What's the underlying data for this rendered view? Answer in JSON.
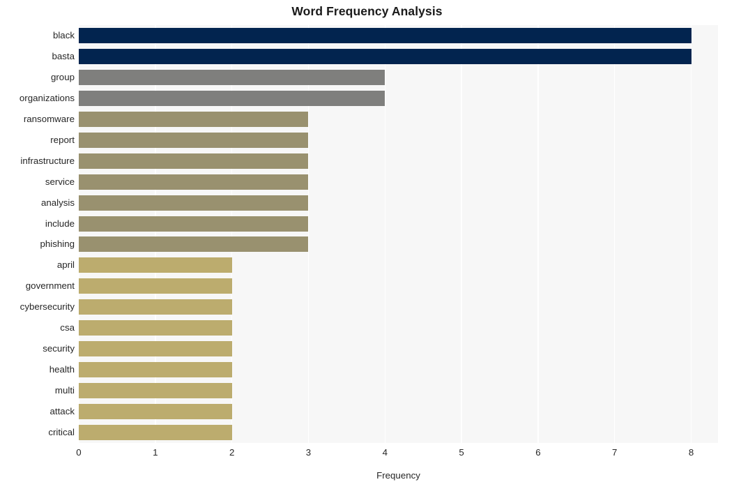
{
  "chart_data": {
    "type": "bar",
    "orientation": "horizontal",
    "title": "Word Frequency Analysis",
    "xlabel": "Frequency",
    "ylabel": "",
    "xlim": [
      0,
      8.35
    ],
    "ylim": [
      0,
      20
    ],
    "grid": true,
    "legend": null,
    "xticks": [
      "0",
      "1",
      "2",
      "3",
      "4",
      "5",
      "6",
      "7",
      "8"
    ],
    "xtick_values": [
      0,
      1,
      2,
      3,
      4,
      5,
      6,
      7,
      8
    ],
    "categories": [
      "black",
      "basta",
      "group",
      "organizations",
      "ransomware",
      "report",
      "infrastructure",
      "service",
      "analysis",
      "include",
      "phishing",
      "april",
      "government",
      "cybersecurity",
      "csa",
      "security",
      "health",
      "multi",
      "attack",
      "critical"
    ],
    "values": [
      8,
      8,
      4,
      4,
      3,
      3,
      3,
      3,
      3,
      3,
      3,
      2,
      2,
      2,
      2,
      2,
      2,
      2,
      2,
      2
    ],
    "bar_colors": [
      "#02244f",
      "#02244f",
      "#7f7f7d",
      "#7f7f7d",
      "#99916f",
      "#99916f",
      "#99916f",
      "#99916f",
      "#99916f",
      "#99916f",
      "#99916f",
      "#bcac6e",
      "#bcac6e",
      "#bcac6e",
      "#bcac6e",
      "#bcac6e",
      "#bcac6e",
      "#bcac6e",
      "#bcac6e",
      "#bcac6e"
    ]
  },
  "style": {
    "plot_background": "#f7f7f7",
    "page_background": "#ffffff",
    "gridline_color": "#ffffff",
    "text_color": "#262626",
    "title_color": "#1a1a1a"
  }
}
